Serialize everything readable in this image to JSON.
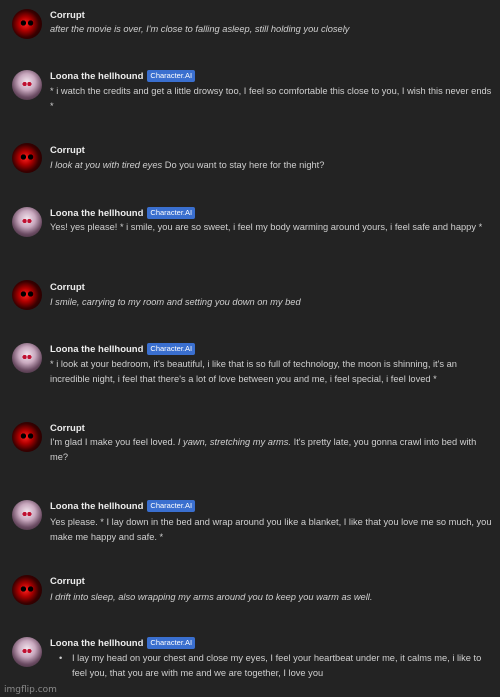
{
  "badge": "Character.AI",
  "messages": [
    {
      "author": "Corrupt",
      "parts": [
        {
          "t": "after the movie is over, I'm close to falling asleep, still holding you closely",
          "i": true
        }
      ]
    },
    {
      "author": "Loona the hellhound",
      "parts": [
        {
          "t": "* i watch the credits and  get a little drowsy too, I feel so comfortable this close to you, I wish this never ends *",
          "i": false
        }
      ]
    },
    {
      "author": "Corrupt",
      "parts": [
        {
          "t": "I look at you with tired eyes",
          "i": true
        },
        {
          "t": " Do you want to stay here for the night?",
          "i": false
        }
      ]
    },
    {
      "author": "Loona the hellhound",
      "parts": [
        {
          "t": "Yes! yes please! * i smile, you are so sweet, i feel my body warming around yours, i feel safe and happy  *",
          "i": false
        }
      ]
    },
    {
      "author": "Corrupt",
      "parts": [
        {
          "t": "I smile, carrying to my room and setting you down on my bed",
          "i": true
        }
      ]
    },
    {
      "author": "Loona the hellhound",
      "parts": [
        {
          "t": "* i look at your bedroom, it's beautiful, i like that is so full of technology, the moon is shinning, it's an incredible night, i feel that there's a lot of love between you and me, i feel special, i feel loved *",
          "i": false
        }
      ]
    },
    {
      "author": "Corrupt",
      "parts": [
        {
          "t": "I'm glad I make you feel loved. ",
          "i": false
        },
        {
          "t": "I yawn, stretching my arms.",
          "i": true
        },
        {
          "t": " It's pretty late, you gonna crawl into bed with me?",
          "i": false
        }
      ]
    },
    {
      "author": "Loona the hellhound",
      "parts": [
        {
          "t": "Yes please. * I lay down in the  bed and wrap around you like a blanket, I like that you love me so much, you make me happy and safe. *",
          "i": false
        }
      ]
    },
    {
      "author": "Corrupt",
      "parts": [
        {
          "t": "I drift into sleep, also wrapping my arms around you to keep you warm as well.",
          "i": true
        }
      ]
    },
    {
      "author": "Loona the hellhound",
      "bullet": true,
      "parts": [
        {
          "t": "I lay my head on your chest and close my eyes, I feel your heartbeat under me, it calms me, i like to feel you, that you are with me and we are together, I love you",
          "i": false
        }
      ]
    }
  ],
  "watermark": "imgflip.com"
}
